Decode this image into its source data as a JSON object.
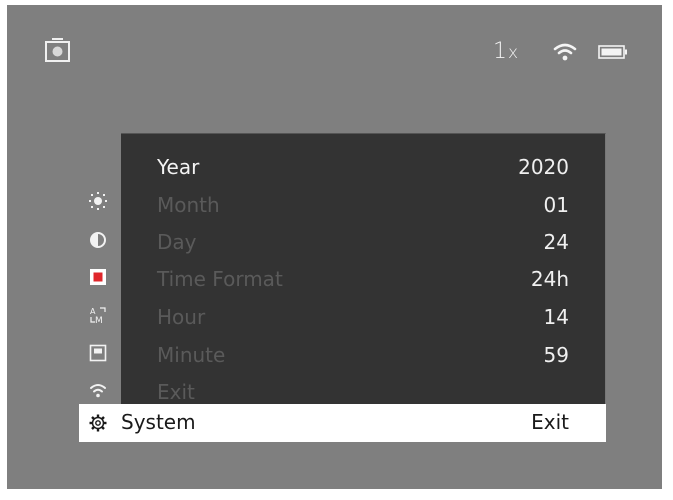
{
  "status": {
    "camera_icon": "camera-icon",
    "zoom_value": "1",
    "zoom_unit": "x",
    "wifi_icon": "wifi-icon",
    "battery_icon": "battery-icon"
  },
  "settings": {
    "rows": [
      {
        "label": "Year",
        "value": "2020",
        "state": "active"
      },
      {
        "label": "Month",
        "value": "01",
        "state": "dim"
      },
      {
        "label": "Day",
        "value": "24",
        "state": "dim"
      },
      {
        "label": "Time Format",
        "value": "24h",
        "state": "dim"
      },
      {
        "label": "Hour",
        "value": "14",
        "state": "dim"
      },
      {
        "label": "Minute",
        "value": "59",
        "state": "dim"
      },
      {
        "label": "Exit",
        "value": "",
        "state": "dim"
      }
    ]
  },
  "side_icons": [
    "brightness-icon",
    "contrast-icon",
    "record-icon",
    "auto-manual-icon",
    "display-mode-icon",
    "wifi-icon",
    "gear-icon"
  ],
  "selected": {
    "label": "System",
    "value": "Exit"
  },
  "colors": {
    "screen_bg": "#7f7f7f",
    "panel_bg": "#333333",
    "accent_red": "#e0262b",
    "bar_bg": "#ffffff"
  }
}
